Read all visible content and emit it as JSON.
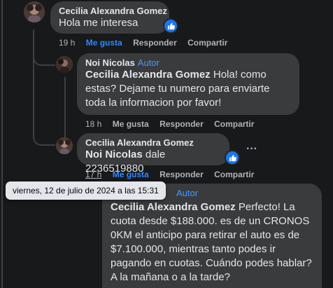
{
  "comments": [
    {
      "author": "Cecilia Alexandra Gomez",
      "text": "Hola me interesa",
      "time": "19 h",
      "like": "Me gusta",
      "reply": "Responder",
      "share": "Compartir"
    },
    {
      "author": "Noi Nicolas",
      "badge": "Autor",
      "mention": "Cecilia Alexandra Gomez",
      "text": " Hola! como estas? Dejame tu numero para enviarte toda la informacion por favor!",
      "time": "18 h",
      "like": "Me gusta",
      "reply": "Responder",
      "share": "Compartir"
    },
    {
      "author": "Cecilia Alexandra Gomez",
      "mention": "Noi Nicolas",
      "text": " dale 2236519880",
      "time": "17 h",
      "like": "Me gusta",
      "reply": "Responder",
      "share": "Compartir",
      "more": "···"
    },
    {
      "badge": "Autor",
      "mention": "Cecilia Alexandra Gomez",
      "text": " Perfecto! La cuota desde $188.000. es de un CRONOS 0KM el anticipo para retirar el auto es de $7.100.000, mientras tanto podes ir pagando en cuotas. Cuándo podes hablar? A la mañana o a la tarde?"
    }
  ],
  "tooltip": "viernes, 12 de julio de 2024 a las 15:31",
  "colors": {
    "background": "#18191a",
    "bubble": "#3a3b3c",
    "accent": "#2d88ff",
    "author_badge": "#4599ff"
  }
}
